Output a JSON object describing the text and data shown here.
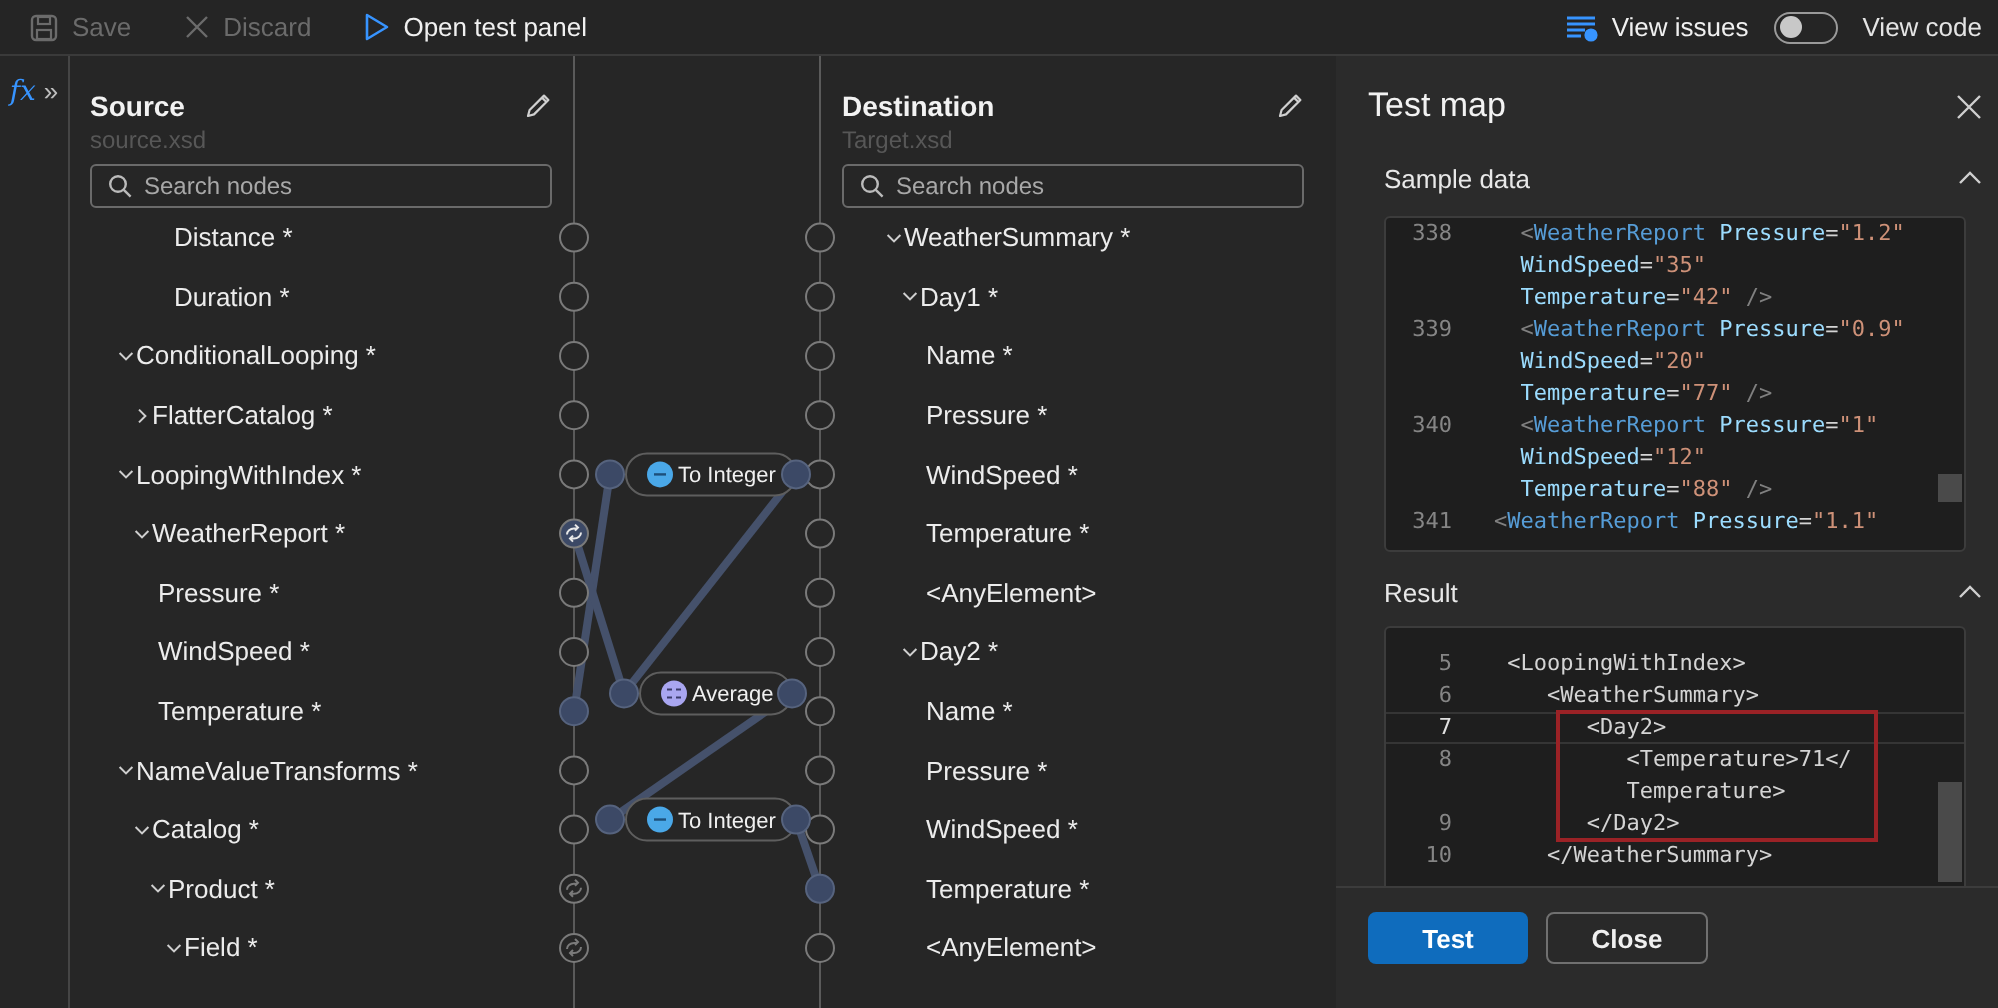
{
  "toolbar": {
    "buttons": [
      {
        "label": "Save",
        "kind": "save",
        "disabled": true
      },
      {
        "label": "Discard",
        "kind": "discard",
        "disabled": true
      },
      {
        "label": "Open test panel",
        "kind": "play",
        "disabled": false
      }
    ],
    "issues": {
      "label": "View issues"
    },
    "code_toggle": {
      "label": "View code",
      "on": false
    }
  },
  "rail": {
    "function_label": "fx",
    "expand_label": "»"
  },
  "source": {
    "title": "Source",
    "file": "source.xsd",
    "search": {
      "placeholder": "Search nodes"
    },
    "items": [
      {
        "children": [
          {
            "children": [
              {
                "children": [
                  {
                    "label": "Distance *",
                    "kind": "open"
                  },
                  {
                    "label": "Duration *",
                    "kind": "open"
                  }
                ]
              }
            ]
          }
        ]
      },
      {
        "label": "ConditionalLooping *",
        "expanded": true,
        "kind": "open",
        "children": [
          {
            "label": "FlatterCatalog *",
            "expanded": false,
            "kind": "open"
          }
        ]
      },
      {
        "label": "LoopingWithIndex *",
        "expanded": true,
        "kind": "open",
        "children": [
          {
            "label": "WeatherReport *",
            "expanded": true,
            "kind": "loop-linked",
            "children": [
              {
                "label": "Pressure *",
                "kind": "open"
              },
              {
                "label": "WindSpeed *",
                "kind": "open"
              },
              {
                "label": "Temperature *",
                "kind": "linked"
              }
            ]
          }
        ]
      },
      {
        "label": "NameValueTransforms *",
        "expanded": true,
        "kind": "open",
        "children": [
          {
            "label": "Catalog *",
            "expanded": true,
            "kind": "open",
            "children": [
              {
                "label": "Product *",
                "expanded": true,
                "kind": "loop",
                "children": [
                  {
                    "label": "Field *",
                    "expanded": true,
                    "kind": "loop"
                  }
                ]
              }
            ]
          }
        ]
      }
    ]
  },
  "mapping": {
    "functions": [
      {
        "label": "To Integer",
        "kind": "conversion"
      },
      {
        "label": "Average",
        "kind": "math"
      },
      {
        "label": "To Integer",
        "kind": "conversion"
      }
    ]
  },
  "destination": {
    "title": "Destination",
    "file": "Target.xsd",
    "search": {
      "placeholder": "Search nodes"
    },
    "items": [
      {
        "children": [
          {
            "label": "WeatherSummary *",
            "expanded": true,
            "kind": "open",
            "children": [
              {
                "label": "Day1 *",
                "expanded": true,
                "kind": "open",
                "children": [
                  {
                    "label": "Name *",
                    "kind": "open"
                  },
                  {
                    "label": "Pressure *",
                    "kind": "open"
                  },
                  {
                    "label": "WindSpeed *",
                    "kind": "open"
                  },
                  {
                    "label": "Temperature *",
                    "kind": "open"
                  },
                  {
                    "label": "<AnyElement>",
                    "kind": "open"
                  }
                ]
              },
              {
                "label": "Day2 *",
                "expanded": true,
                "kind": "open",
                "children": [
                  {
                    "label": "Name *",
                    "kind": "open"
                  },
                  {
                    "label": "Pressure *",
                    "kind": "open"
                  },
                  {
                    "label": "WindSpeed *",
                    "kind": "open"
                  },
                  {
                    "label": "Temperature *",
                    "kind": "linked"
                  },
                  {
                    "label": "<AnyElement>",
                    "kind": "open"
                  }
                ]
              }
            ]
          }
        ]
      }
    ]
  },
  "test_panel": {
    "title": "Test map",
    "sections": [
      {
        "title": "Sample data",
        "expanded": true,
        "highlight": true,
        "lines": [
          {
            "number": "338",
            "text": "  <WeatherReport Pressure=\"1.2\""
          },
          {
            "text": "  WindSpeed=\"35\""
          },
          {
            "text": "  Temperature=\"42\" />"
          },
          {
            "number": "339",
            "text": "  <WeatherReport Pressure=\"0.9\""
          },
          {
            "text": "  WindSpeed=\"20\""
          },
          {
            "text": "  Temperature=\"77\" />"
          },
          {
            "number": "340",
            "text": "  <WeatherReport Pressure=\"1\""
          },
          {
            "text": "  WindSpeed=\"12\""
          },
          {
            "text": "  Temperature=\"88\" />"
          },
          {
            "number": "341",
            "text": "<WeatherReport Pressure=\"1.1\""
          }
        ]
      },
      {
        "title": "Result",
        "expanded": true,
        "highlight": false,
        "lines": [
          {
            "number": "5",
            "text": " <LoopingWithIndex>"
          },
          {
            "number": "6",
            "text": "    <WeatherSummary>"
          },
          {
            "number": "7",
            "text": "       <Day2>",
            "current": true,
            "framed": true
          },
          {
            "number": "8",
            "text": "          <Temperature>71</",
            "framed": true
          },
          {
            "text": "          Temperature>",
            "framed": true
          },
          {
            "number": "9",
            "text": "       </Day2>",
            "framed": true
          },
          {
            "number": "10",
            "text": "    </WeatherSummary>"
          }
        ]
      }
    ],
    "buttons": [
      {
        "label": "Test",
        "kind": "primary"
      },
      {
        "label": "Close",
        "kind": "secondary"
      }
    ]
  }
}
